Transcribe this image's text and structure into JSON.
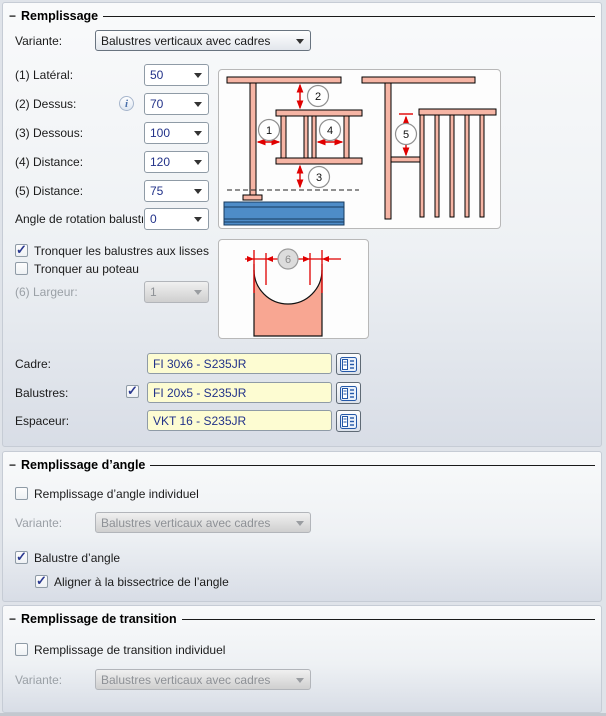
{
  "ui": {
    "collapse_glyph": "−"
  },
  "colors": {
    "field_yellow": "#fdfcd2",
    "value_blue": "#223289",
    "dimension_red": "#e00000",
    "bar_salmon": "#f6b5a5",
    "beam_blue": "#4e8cc8"
  },
  "remplissage": {
    "title": "Remplissage",
    "variante": {
      "label": "Variante:",
      "value": "Balustres verticaux avec cadres"
    },
    "params": [
      {
        "label": "(1) Latéral:",
        "value": "50"
      },
      {
        "label": "(2) Dessus:",
        "value": "70"
      },
      {
        "label": "(3) Dessous:",
        "value": "100"
      },
      {
        "label": "(4) Distance:",
        "value": "120"
      },
      {
        "label": "(5) Distance:",
        "value": "75"
      },
      {
        "label": "Angle de rotation balustr",
        "value": "0"
      }
    ],
    "options": [
      {
        "label": "Tronquer les balustres aux lisses",
        "checked": true
      },
      {
        "label": "Tronquer au poteau",
        "checked": false
      }
    ],
    "largeur": {
      "label": "(6) Largeur:",
      "value": "1"
    },
    "profiles": [
      {
        "label": "Cadre:",
        "value": "FI 30x6 - S235JR",
        "checked": false
      },
      {
        "label": "Balustres:",
        "value": "FI 20x5 - S235JR",
        "checked": true
      },
      {
        "label": "Espaceur:",
        "value": "VKT 16 - S235JR",
        "checked": false
      }
    ]
  },
  "angle": {
    "title": "Remplissage d’angle",
    "individual": {
      "label": "Remplissage d’angle individuel",
      "checked": false
    },
    "variante": {
      "label": "Variante:",
      "value": "Balustres verticaux avec cadres"
    },
    "balustre": {
      "label": "Balustre d’angle",
      "checked": true
    },
    "bissectrice": {
      "label": "Aligner à la bissectrice de l’angle",
      "checked": true
    }
  },
  "transition": {
    "title": "Remplissage de transition",
    "individual": {
      "label": "Remplissage de transition individuel",
      "checked": false
    },
    "variante": {
      "label": "Variante:",
      "value": "Balustres verticaux avec cadres"
    }
  },
  "diagrams": {
    "railing": {
      "callouts": [
        "1",
        "2",
        "3",
        "4",
        "5"
      ]
    },
    "cut": {
      "callout": "6"
    }
  }
}
